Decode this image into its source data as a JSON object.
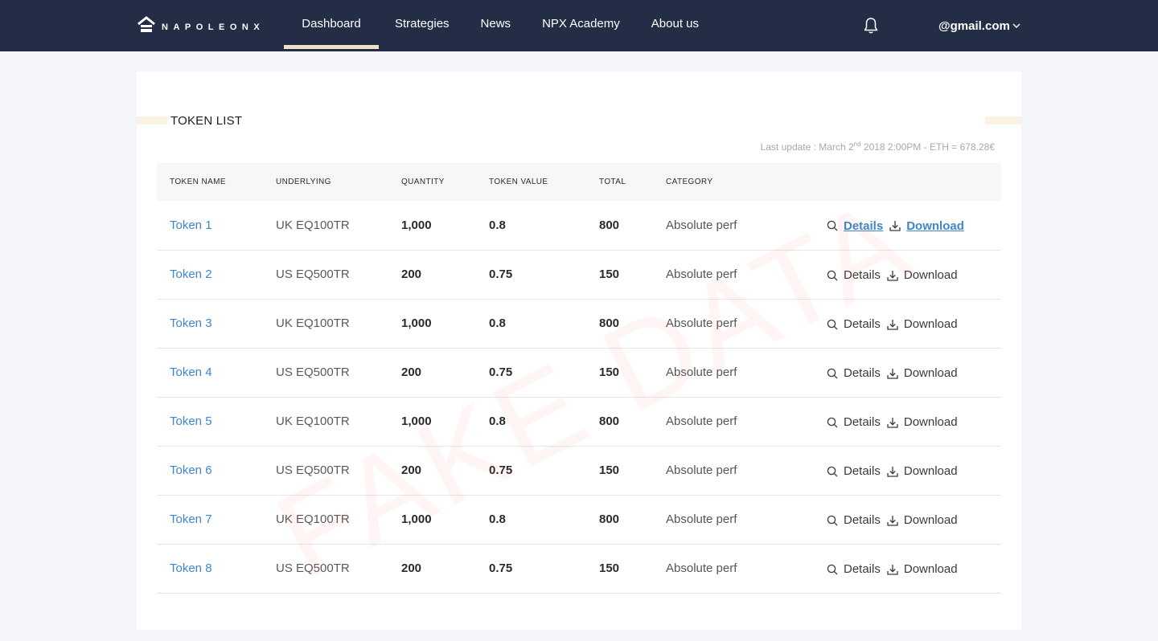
{
  "header": {
    "brand": "NAPOLEONX",
    "nav": [
      {
        "label": "Dashboard",
        "active": true
      },
      {
        "label": "Strategies"
      },
      {
        "label": "News"
      },
      {
        "label": "NPX Academy"
      },
      {
        "label": "About us"
      }
    ],
    "account": "@gmail.com"
  },
  "token_list": {
    "title": "TOKEN LIST",
    "last_update_prefix": "Last update : March 2",
    "last_update_suffix": "nd",
    "last_update_rest": " 2018 2:00PM - ETH = 678.28€",
    "columns": [
      "TOKEN NAME",
      "UNDERLYING",
      "QUANTITY",
      "TOKEN VALUE",
      "TOTAL",
      "CATEGORY"
    ],
    "actions": {
      "details": "Details",
      "download": "Download"
    },
    "rows": [
      {
        "name": "Token 1",
        "underlying": "UK EQ100TR",
        "quantity": "1,000",
        "value": "0.8",
        "total": "800",
        "category": "Absolute perf"
      },
      {
        "name": "Token 2",
        "underlying": "US EQ500TR",
        "quantity": "200",
        "value": "0.75",
        "total": "150",
        "category": "Absolute perf"
      },
      {
        "name": "Token 3",
        "underlying": "UK EQ100TR",
        "quantity": "1,000",
        "value": "0.8",
        "total": "800",
        "category": "Absolute perf"
      },
      {
        "name": "Token 4",
        "underlying": "US EQ500TR",
        "quantity": "200",
        "value": "0.75",
        "total": "150",
        "category": "Absolute perf"
      },
      {
        "name": "Token 5",
        "underlying": "UK EQ100TR",
        "quantity": "1,000",
        "value": "0.8",
        "total": "800",
        "category": "Absolute perf"
      },
      {
        "name": "Token 6",
        "underlying": "US EQ500TR",
        "quantity": "200",
        "value": "0.75",
        "total": "150",
        "category": "Absolute perf"
      },
      {
        "name": "Token 7",
        "underlying": "UK EQ100TR",
        "quantity": "1,000",
        "value": "0.8",
        "total": "800",
        "category": "Absolute perf"
      },
      {
        "name": "Token 8",
        "underlying": "US EQ500TR",
        "quantity": "200",
        "value": "0.75",
        "total": "150",
        "category": "Absolute perf"
      }
    ]
  },
  "watermark": "FAKE DATA",
  "colors": {
    "header_bg": "#232d45",
    "active_tab": "#ede2c5",
    "link": "#3f86c9",
    "page_bg": "#f4f5f9"
  },
  "icons": {
    "logo": "house-logo-icon",
    "bell": "bell-icon",
    "chevron": "chevron-down-icon",
    "details": "search-icon",
    "download": "download-icon"
  }
}
